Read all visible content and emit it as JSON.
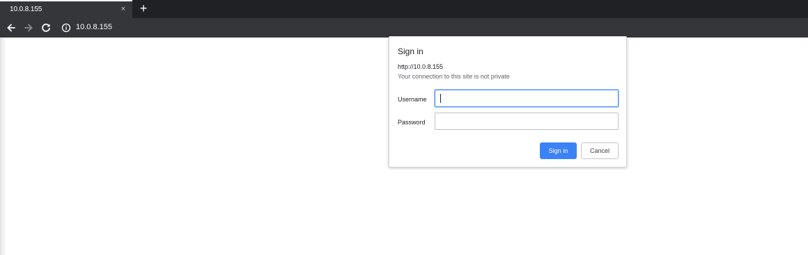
{
  "browser": {
    "tab": {
      "title": "10.0.8.155",
      "close_glyph": "×"
    },
    "new_tab_glyph": "+",
    "address": {
      "url": "10.0.8.155"
    },
    "icons": {
      "back": "back-arrow-icon",
      "forward": "forward-arrow-icon",
      "reload": "reload-icon",
      "info": "info-icon"
    }
  },
  "dialog": {
    "title": "Sign in",
    "origin": "http://10.0.8.155",
    "warning": "Your connection to this site is not private",
    "username_label": "Username",
    "username_value": "",
    "password_label": "Password",
    "password_value": "",
    "signin_label": "Sign in",
    "cancel_label": "Cancel",
    "accent_color": "#3b82f6"
  }
}
